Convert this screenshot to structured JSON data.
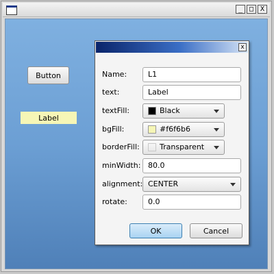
{
  "window": {
    "minimize_glyph": "_",
    "maximize_glyph": "□",
    "close_glyph": "X"
  },
  "main": {
    "button_label": "Button",
    "label_text": "Label",
    "label_bg": "#f6f6b6"
  },
  "dialog": {
    "close_glyph": "x",
    "fields": {
      "name": {
        "label": "Name:",
        "value": "L1"
      },
      "text": {
        "label": "text:",
        "value": "Label"
      },
      "textFill": {
        "label": "textFill:",
        "value": "Black",
        "swatch": "#000000"
      },
      "bgFill": {
        "label": "bgFill:",
        "value": "#f6f6b6",
        "swatch": "#f6f6b6"
      },
      "borderFill": {
        "label": "borderFill:",
        "value": "Transparent",
        "swatch": "transparent"
      },
      "minWidth": {
        "label": "minWidth:",
        "value": "80.0"
      },
      "alignment": {
        "label": "alignment:",
        "value": "CENTER"
      },
      "rotate": {
        "label": "rotate:",
        "value": "0.0"
      }
    },
    "ok_label": "OK",
    "cancel_label": "Cancel"
  }
}
